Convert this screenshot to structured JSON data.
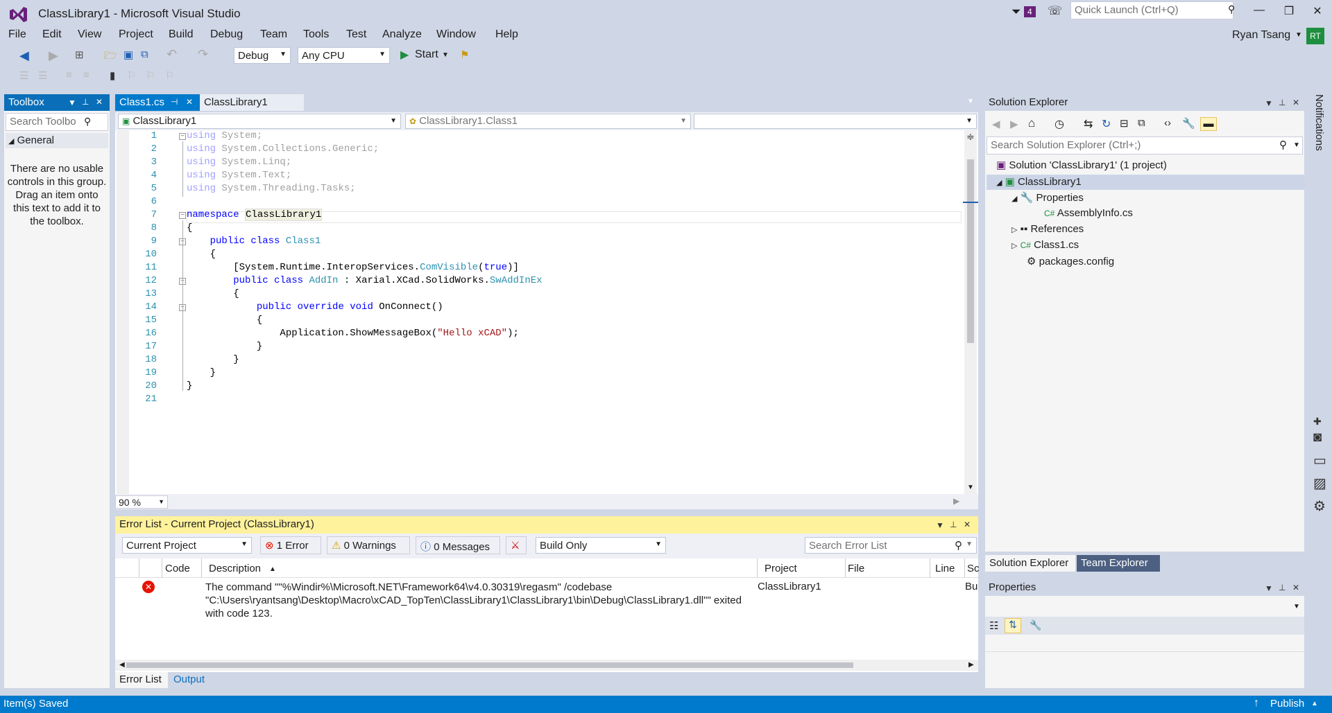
{
  "window": {
    "title": "ClassLibrary1 - Microsoft Visual Studio",
    "notif_count": "4",
    "quick_launch_placeholder": "Quick Launch (Ctrl+Q)",
    "user_name": "Ryan Tsang",
    "user_initials": "RT"
  },
  "menu": [
    "File",
    "Edit",
    "View",
    "Project",
    "Build",
    "Debug",
    "Team",
    "Tools",
    "Test",
    "Analyze",
    "Window",
    "Help"
  ],
  "toolbar": {
    "config": "Debug",
    "platform": "Any CPU",
    "start_label": "Start"
  },
  "toolbox": {
    "title": "Toolbox",
    "search_placeholder": "Search Toolbo",
    "group": "General",
    "message": "There are no usable controls in this group. Drag an item onto this text to add it to the toolbox."
  },
  "tabs": [
    {
      "label": "Class1.cs"
    },
    {
      "label": "ClassLibrary1"
    }
  ],
  "nav": {
    "project": "ClassLibrary1",
    "type": "ClassLibrary1.Class1"
  },
  "editor": {
    "zoom": "90 %",
    "line_numbers": [
      "1",
      "2",
      "3",
      "4",
      "5",
      "6",
      "7",
      "8",
      "9",
      "10",
      "11",
      "12",
      "13",
      "14",
      "15",
      "16",
      "17",
      "18",
      "19",
      "20",
      "21"
    ]
  },
  "error_list": {
    "title": "Error List - Current Project (ClassLibrary1)",
    "scope": "Current Project",
    "errors_label": "1 Error",
    "warnings_label": "0 Warnings",
    "messages_label": "0 Messages",
    "build_filter": "Build Only",
    "search_placeholder": "Search Error List",
    "columns": {
      "code": "Code",
      "description": "Description",
      "project": "Project",
      "file": "File",
      "line": "Line",
      "suppression": "Sc"
    },
    "rows": [
      {
        "description": "The command \"\"%Windir%\\Microsoft.NET\\Framework64\\v4.0.30319\\regasm\" /codebase \"C:\\Users\\ryantsang\\Desktop\\Macro\\xCAD_TopTen\\ClassLibrary1\\ClassLibrary1\\bin\\Debug\\ClassLibrary1.dll\"\" exited with code 123.",
        "project": "ClassLibrary1",
        "suppression": "Bu"
      }
    ],
    "bottom_tabs": [
      "Error List",
      "Output"
    ]
  },
  "solution_explorer": {
    "title": "Solution Explorer",
    "search_placeholder": "Search Solution Explorer (Ctrl+;)",
    "tree": [
      "Solution 'ClassLibrary1' (1 project)",
      "ClassLibrary1",
      "Properties",
      "AssemblyInfo.cs",
      "References",
      "Class1.cs",
      "packages.config"
    ],
    "tabs": [
      "Solution Explorer",
      "Team Explorer"
    ]
  },
  "properties": {
    "title": "Properties"
  },
  "side": {
    "notifications": "Notifications"
  },
  "status": {
    "left": "Item(s) Saved",
    "publish": "Publish"
  }
}
